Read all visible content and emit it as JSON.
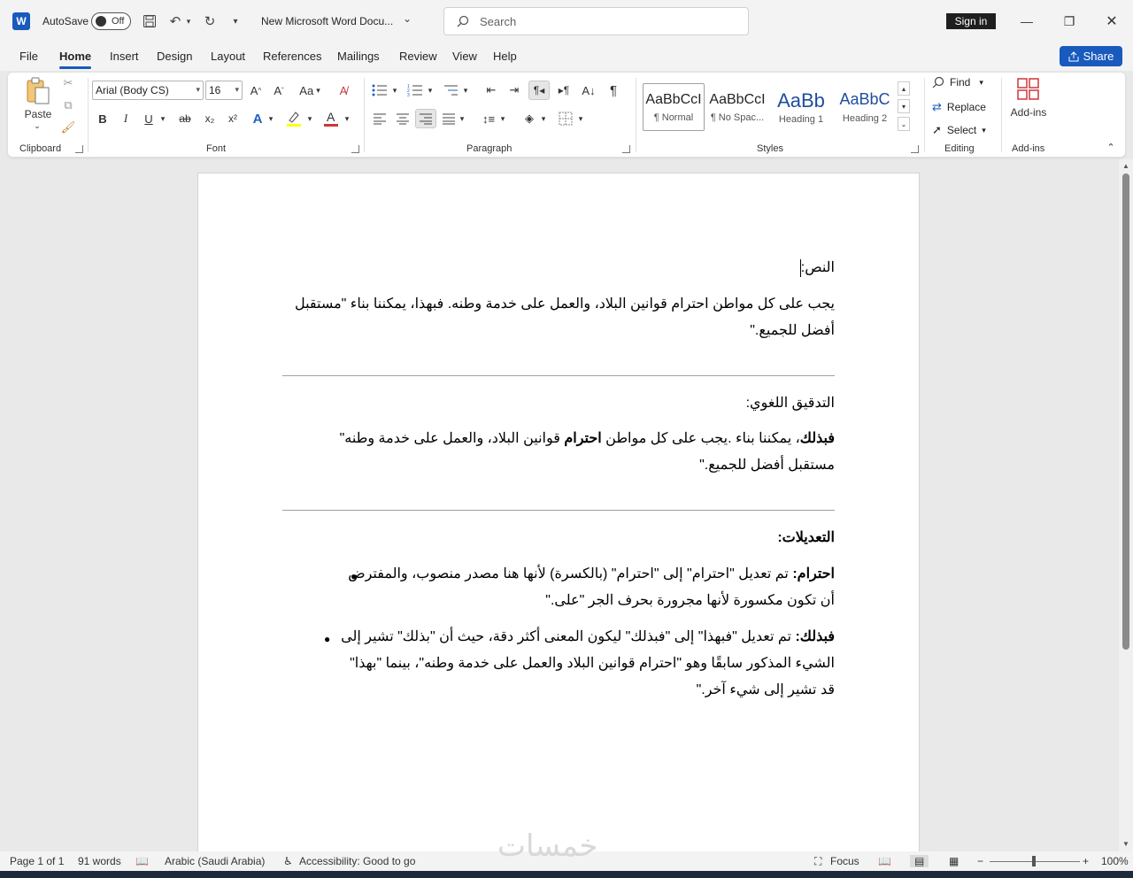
{
  "titlebar": {
    "app_icon": "W",
    "autosave_label": "AutoSave",
    "autosave_state": "Off",
    "doc_title": "New Microsoft Word Docu...",
    "search_placeholder": "Search",
    "signin_label": "Sign in"
  },
  "menu": {
    "tabs": [
      "File",
      "Home",
      "Insert",
      "Design",
      "Layout",
      "References",
      "Mailings",
      "Review",
      "View",
      "Help"
    ],
    "active_tab": "Home",
    "share_label": "Share"
  },
  "ribbon": {
    "clipboard": {
      "paste_label": "Paste",
      "group_label": "Clipboard"
    },
    "font": {
      "font_name": "Arial (Body CS)",
      "font_size": "16",
      "case_label": "Aa",
      "bold": "B",
      "italic": "I",
      "underline": "U",
      "strike": "ab",
      "subscript": "x₂",
      "superscript": "x²",
      "group_label": "Font"
    },
    "paragraph": {
      "group_label": "Paragraph",
      "pilcrow": "¶"
    },
    "styles": {
      "items": [
        {
          "sample": "AaBbCcI",
          "name": "¶ Normal"
        },
        {
          "sample": "AaBbCcI",
          "name": "¶ No Spac..."
        },
        {
          "sample": "AaBb",
          "name": "Heading 1"
        },
        {
          "sample": "AaBbC",
          "name": "Heading 2"
        }
      ],
      "group_label": "Styles"
    },
    "editing": {
      "find": "Find",
      "replace": "Replace",
      "select": "Select",
      "group_label": "Editing"
    },
    "addins": {
      "label": "Add-ins",
      "group_label": "Add-ins"
    }
  },
  "document": {
    "heading1": "النص:",
    "text1": "يجب على كل مواطن احترام قوانين البلاد، والعمل على خدمة وطنه. فبهذا، يمكننا بناء \"مستقبل أفضل للجميع.\"",
    "heading2": "التدقيق اللغوي:",
    "text2_bold1": "فبذلك",
    "text2_part1": "، يمكننا بناء  .يجب على كل مواطن ",
    "text2_bold2": "احترام",
    "text2_part2": " قوانين البلاد، والعمل على خدمة وطنه\"",
    "text2_line2": "مستقبل أفضل للجميع.\"",
    "heading3": "التعديلات:",
    "bullet1_bold": "احترام:",
    "bullet1_text": " تم تعديل \"احترام\" إلى \"احترام\" (بالكسرة) لأنها هنا مصدر منصوب، والمفترض أن تكون مكسورة لأنها مجرورة بحرف الجر \"على.\"",
    "bullet2_bold": "فبذلك:",
    "bullet2_text": " تم تعديل \"فبهذا\" إلى \"فبذلك\" ليكون المعنى أكثر دقة، حيث أن \"بذلك\" تشير إلى الشيء المذكور سابقًا وهو \"احترام قوانين البلاد والعمل على خدمة وطنه\"، بينما \"بهذا\" قد تشير إلى شيء آخر.\""
  },
  "watermark": "خمسات",
  "statusbar": {
    "page": "Page 1 of 1",
    "words": "91 words",
    "language": "Arabic (Saudi Arabia)",
    "accessibility": "Accessibility: Good to go",
    "focus": "Focus",
    "zoom": "100%"
  }
}
